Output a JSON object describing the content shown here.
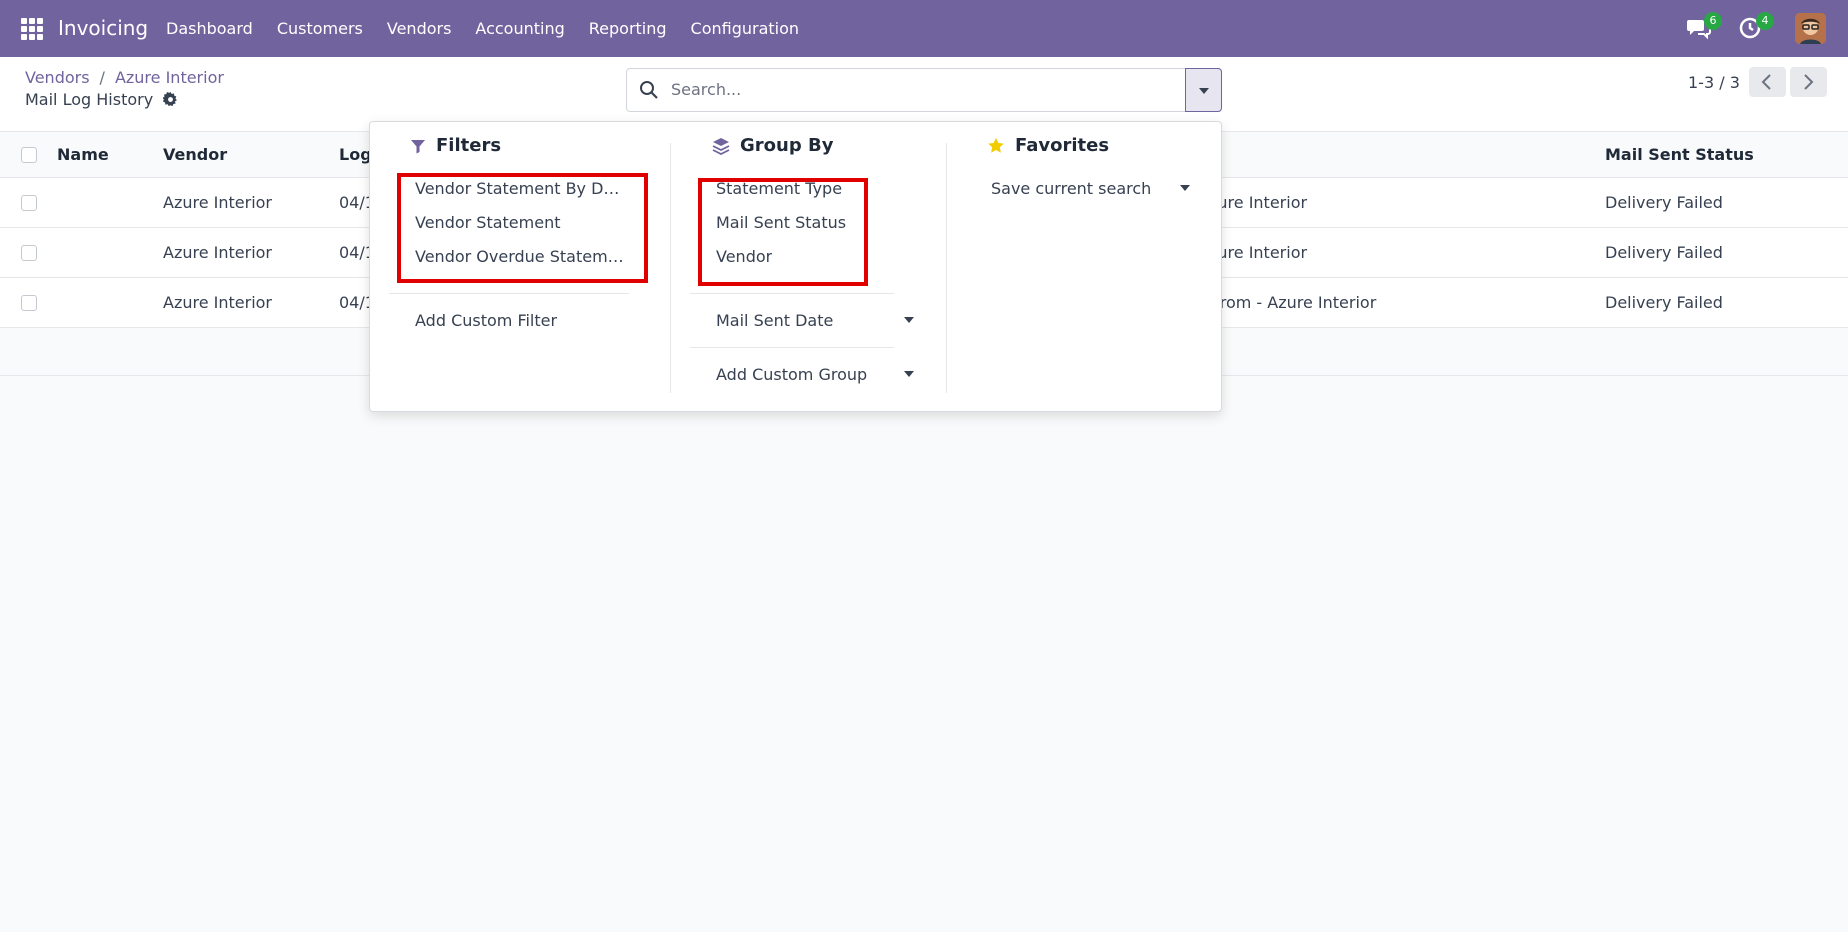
{
  "navbar": {
    "brand": "Invoicing",
    "menu": [
      "Dashboard",
      "Customers",
      "Vendors",
      "Accounting",
      "Reporting",
      "Configuration"
    ],
    "messages_badge": "6",
    "activities_badge": "4",
    "color": "#71639e"
  },
  "control": {
    "breadcrumb": [
      "Vendors",
      "Azure Interior"
    ],
    "title": "Mail Log History",
    "search_placeholder": "Search...",
    "pager": "1-3 / 3"
  },
  "list": {
    "headers": [
      "Name",
      "Vendor",
      "Log",
      "Mail Sent Status"
    ],
    "rows": [
      {
        "vendor": "Azure Interior",
        "log": "04/1",
        "subject": "zure Interior",
        "status": "Delivery Failed"
      },
      {
        "vendor": "Azure Interior",
        "log": "04/1",
        "subject": "zure Interior",
        "status": "Delivery Failed"
      },
      {
        "vendor": "Azure Interior",
        "log": "04/1",
        "subject": " from - Azure Interior",
        "status": "Delivery Failed"
      }
    ]
  },
  "dropdown": {
    "filters": {
      "title": "Filters",
      "items": [
        "Vendor Statement By D…",
        "Vendor Statement",
        "Vendor Overdue Statem…"
      ],
      "custom": "Add Custom Filter"
    },
    "groupby": {
      "title": "Group By",
      "items": [
        "Statement Type",
        "Mail Sent Status",
        "Vendor"
      ],
      "date": "Mail Sent Date",
      "custom": "Add Custom Group"
    },
    "favorites": {
      "title": "Favorites",
      "save": "Save current search"
    },
    "highlight_color": "#e00000"
  }
}
